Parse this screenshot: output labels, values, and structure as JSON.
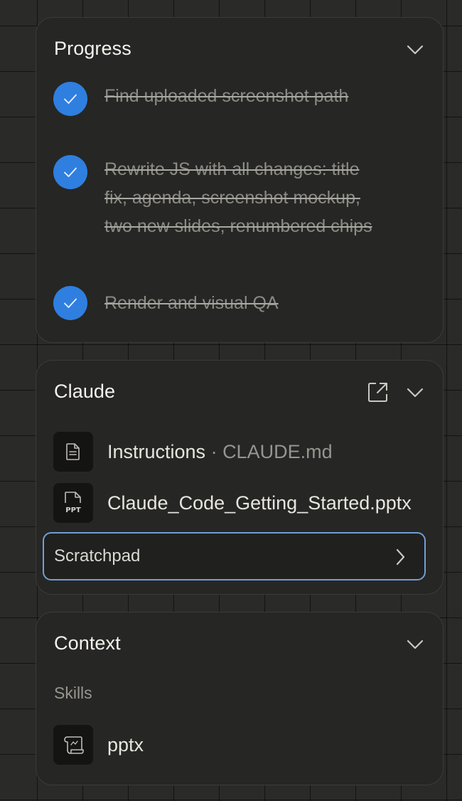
{
  "progress": {
    "title": "Progress",
    "tasks": [
      {
        "text": "Find uploaded screenshot path",
        "done": true
      },
      {
        "text": "Rewrite JS with all changes: title fix, agenda, screenshot mockup, two new slides, renumbered chips",
        "done": true
      },
      {
        "text": "Render and visual QA",
        "done": true
      }
    ]
  },
  "claude": {
    "title": "Claude",
    "files": [
      {
        "name": "Instructions",
        "separator": " · ",
        "detail": "CLAUDE.md",
        "icon": "document-icon"
      },
      {
        "name": "Claude_Code_Getting_Started.pptx",
        "icon": "ppt-file-icon",
        "badge": "PPT"
      }
    ],
    "scratchpad": "Scratchpad"
  },
  "context": {
    "title": "Context",
    "section": "Skills",
    "skills": [
      {
        "name": "pptx",
        "icon": "scroll-icon"
      }
    ]
  },
  "colors": {
    "accent": "#2f7fe0",
    "focus": "#6f9fd8",
    "panel": "#262624",
    "background": "#2a2a28"
  }
}
